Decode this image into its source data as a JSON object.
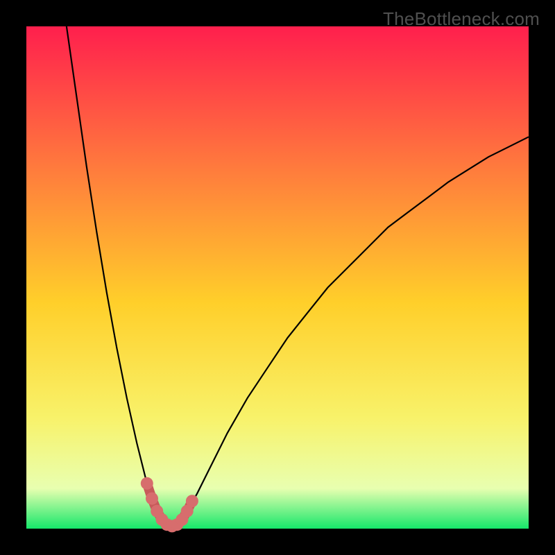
{
  "watermark": "TheBottleneck.com",
  "colors": {
    "frame": "#000000",
    "grad_top": "#ff1f4d",
    "grad_mid_upper": "#ff7a3d",
    "grad_mid": "#ffcf2a",
    "grad_mid_lower": "#f8f26a",
    "grad_low": "#e8ffb0",
    "grad_bottom": "#16e76a",
    "curve": "#000000",
    "marker_fill": "#d76d6d",
    "marker_stroke": "#c75a5a"
  },
  "chart_data": {
    "type": "line",
    "title": "",
    "xlabel": "",
    "ylabel": "",
    "xlim": [
      0,
      100
    ],
    "ylim": [
      0,
      100
    ],
    "notes": "V-shaped bottleneck curve; y≈0 is optimal (green), high y is bad (red). Minimum near x≈28.",
    "series": [
      {
        "name": "bottleneck-curve",
        "x": [
          8,
          10,
          12,
          14,
          16,
          18,
          20,
          22,
          24,
          25,
          26,
          27,
          28,
          29,
          30,
          31,
          32,
          34,
          36,
          38,
          40,
          44,
          48,
          52,
          56,
          60,
          64,
          68,
          72,
          76,
          80,
          84,
          88,
          92,
          96,
          100
        ],
        "y": [
          100,
          86,
          72,
          59,
          47,
          36,
          26,
          17,
          9,
          6,
          3.5,
          1.8,
          0.8,
          0.5,
          0.8,
          1.8,
          3.5,
          7,
          11,
          15,
          19,
          26,
          32,
          38,
          43,
          48,
          52,
          56,
          60,
          63,
          66,
          69,
          71.5,
          74,
          76,
          78
        ]
      }
    ],
    "markers": {
      "name": "highlighted-minimum",
      "x": [
        24,
        25,
        26,
        27,
        28,
        29,
        30,
        31,
        32,
        33
      ],
      "y": [
        9,
        6,
        3.5,
        1.8,
        0.8,
        0.5,
        0.8,
        1.8,
        3.5,
        5.5
      ]
    }
  }
}
